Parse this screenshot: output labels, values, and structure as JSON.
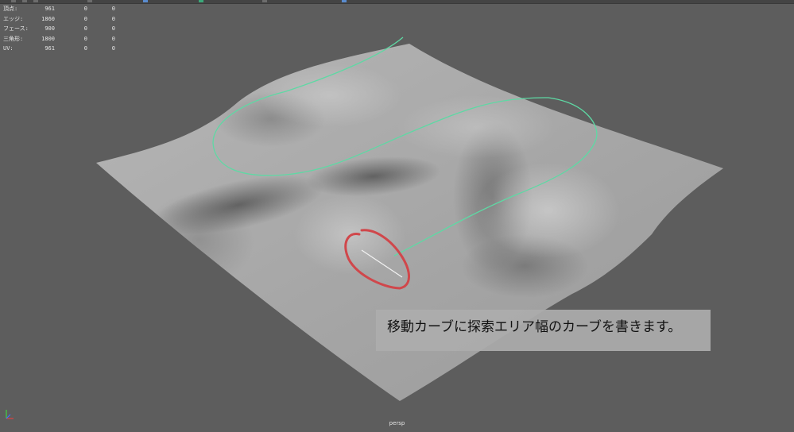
{
  "viewport": {
    "camera_label": "persp",
    "curve_color": "#5ed9a4",
    "annotation_color": "#d0474b",
    "background_color": "#5d5d5d"
  },
  "hud": {
    "rows": [
      {
        "label": "頂点:",
        "v1": "961",
        "v2": "0",
        "v3": "0"
      },
      {
        "label": "エッジ:",
        "v1": "1860",
        "v2": "0",
        "v3": "0"
      },
      {
        "label": "フェース:",
        "v1": "900",
        "v2": "0",
        "v3": "0"
      },
      {
        "label": "三角形:",
        "v1": "1800",
        "v2": "0",
        "v3": "0"
      },
      {
        "label": "UV:",
        "v1": "961",
        "v2": "0",
        "v3": "0"
      }
    ]
  },
  "caption": {
    "text": "移動カーブに探索エリア幅のカーブを書きます。"
  },
  "axis": {
    "icon": "axis-gizmo-icon",
    "x_color": "#e04040",
    "y_color": "#40d040",
    "z_color": "#4070ff"
  }
}
